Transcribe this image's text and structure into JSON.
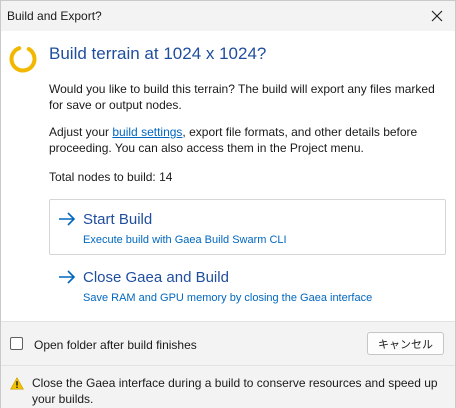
{
  "window": {
    "title": "Build and Export?"
  },
  "main": {
    "heading": "Build terrain at 1024 x 1024?",
    "para1": "Would you like to build this terrain? The build will export any files marked for save or output nodes.",
    "para2_before": "Adjust your ",
    "para2_link": "build settings",
    "para2_after": ", export file formats, and other details before proceeding. You can also access them in the Project menu.",
    "total_nodes": "Total nodes to build: 14"
  },
  "options": [
    {
      "title": "Start Build",
      "subtitle": "Execute build with Gaea Build Swarm CLI",
      "icon": "arrow-right-icon"
    },
    {
      "title": "Close Gaea and Build",
      "subtitle": "Save RAM and GPU memory by closing the Gaea interface",
      "icon": "arrow-right-icon"
    }
  ],
  "footer": {
    "checkbox_label": "Open folder after build finishes",
    "checkbox_checked": false,
    "cancel_label": "キャンセル"
  },
  "note": {
    "icon": "warning-icon",
    "text": "Close the Gaea interface during a build to conserve resources and speed up your builds."
  },
  "colors": {
    "accent": "#1f4e9e",
    "link": "#0067c0",
    "spinner": "#f2b800",
    "warning": "#f2c200"
  }
}
